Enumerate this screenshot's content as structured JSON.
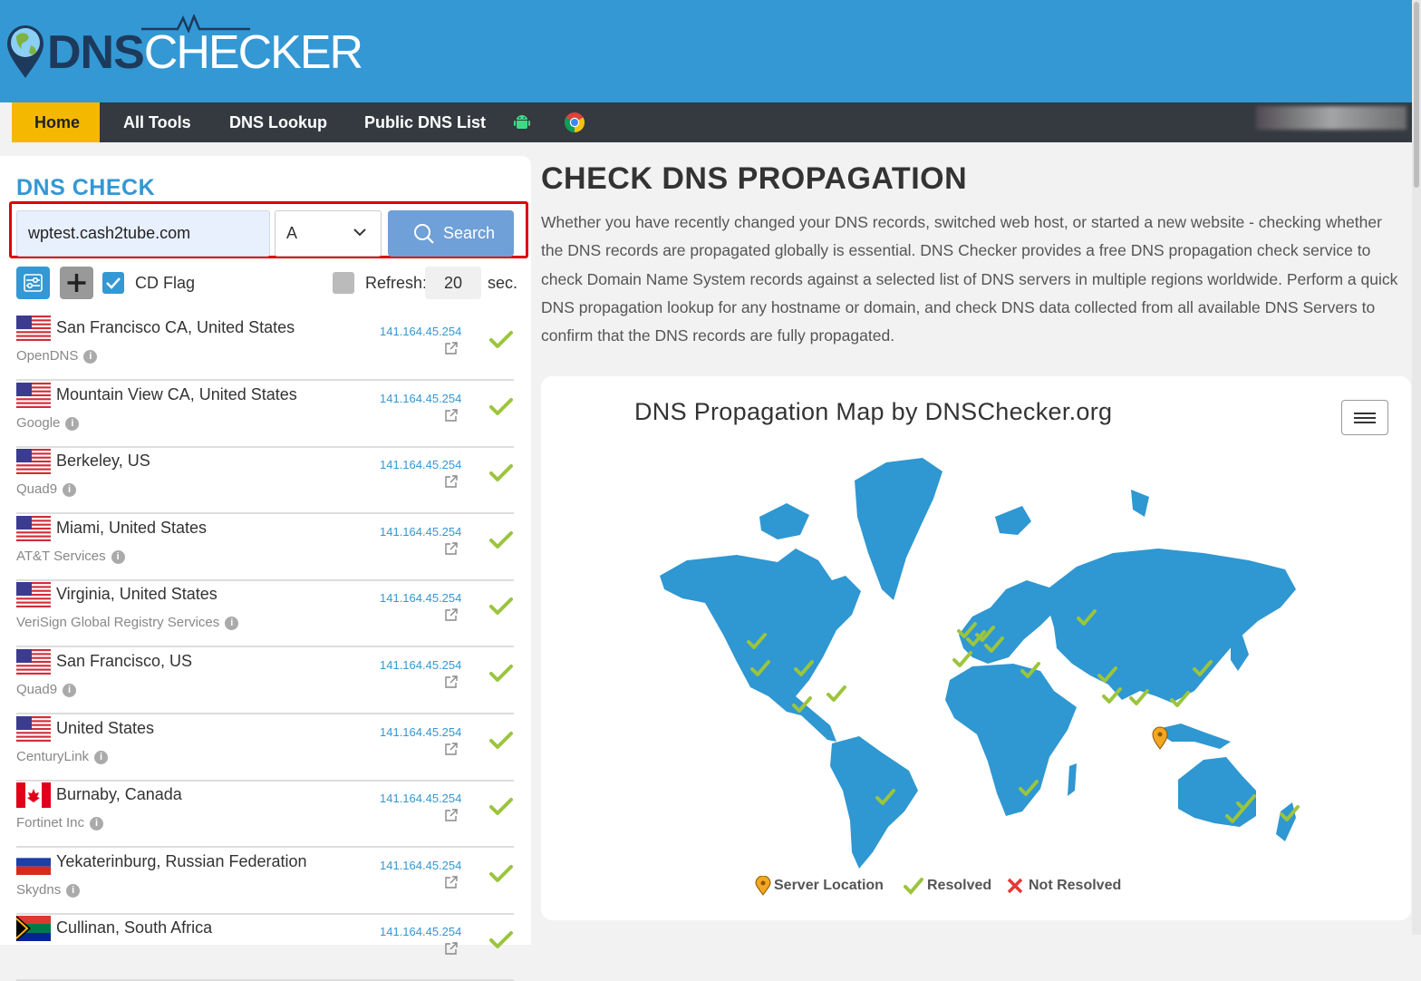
{
  "brand": {
    "name_bold": "DNS",
    "name_light": "CHECKER"
  },
  "nav": {
    "items": [
      "Home",
      "All Tools",
      "DNS Lookup",
      "Public DNS List"
    ],
    "active": "Home",
    "icons": [
      "android-icon",
      "chrome-icon"
    ]
  },
  "dns_check": {
    "title": "DNS CHECK",
    "domain_value": "wptest.cash2tube.com",
    "record_type": "A",
    "search_label": "Search",
    "cd_flag_label": "CD Flag",
    "cd_flag_checked": true,
    "refresh_label": "Refresh:",
    "refresh_value": "20",
    "refresh_unit": "sec.",
    "refresh_checked": false
  },
  "servers": [
    {
      "location": "San Francisco CA, United States",
      "provider": "OpenDNS",
      "ip": "141.164.45.254",
      "flag": "us",
      "status": "resolved"
    },
    {
      "location": "Mountain View CA, United States",
      "provider": "Google",
      "ip": "141.164.45.254",
      "flag": "us",
      "status": "resolved"
    },
    {
      "location": "Berkeley, US",
      "provider": "Quad9",
      "ip": "141.164.45.254",
      "flag": "us",
      "status": "resolved"
    },
    {
      "location": "Miami, United States",
      "provider": "AT&T Services",
      "ip": "141.164.45.254",
      "flag": "us",
      "status": "resolved"
    },
    {
      "location": "Virginia, United States",
      "provider": "VeriSign Global Registry Services",
      "ip": "141.164.45.254",
      "flag": "us",
      "status": "resolved"
    },
    {
      "location": "San Francisco, US",
      "provider": "Quad9",
      "ip": "141.164.45.254",
      "flag": "us",
      "status": "resolved"
    },
    {
      "location": "United States",
      "provider": "CenturyLink",
      "ip": "141.164.45.254",
      "flag": "us",
      "status": "resolved"
    },
    {
      "location": "Burnaby, Canada",
      "provider": "Fortinet Inc",
      "ip": "141.164.45.254",
      "flag": "ca",
      "status": "resolved"
    },
    {
      "location": "Yekaterinburg, Russian Federation",
      "provider": "Skydns",
      "ip": "141.164.45.254",
      "flag": "ru",
      "status": "resolved"
    },
    {
      "location": "Cullinan, South Africa",
      "provider": "",
      "ip": "141.164.45.254",
      "flag": "za",
      "status": "resolved"
    }
  ],
  "main": {
    "title": "CHECK DNS PROPAGATION",
    "intro": "Whether you have recently changed your DNS records, switched web host, or started a new website - checking whether the DNS records are propagated globally is essential. DNS Checker provides a free DNS propagation check service to check Domain Name System records against a selected list of DNS servers in multiple regions worldwide. Perform a quick DNS propagation lookup for any hostname or domain, and check DNS data collected from all available DNS Servers to confirm that the DNS records are fully propagated."
  },
  "map": {
    "title": "DNS Propagation Map by DNSChecker.org",
    "legend": {
      "server": "Server Location",
      "resolved": "Resolved",
      "not_resolved": "Not Resolved"
    },
    "colors": {
      "land": "#2f97d1",
      "resolved": "#9bc53d",
      "server": "#f5a623",
      "not_resolved": "#e53935"
    }
  },
  "colors": {
    "brand_blue": "#3398d4",
    "nav_dark": "#343a40",
    "nav_active": "#f5b800",
    "alert_red": "#e00000"
  }
}
